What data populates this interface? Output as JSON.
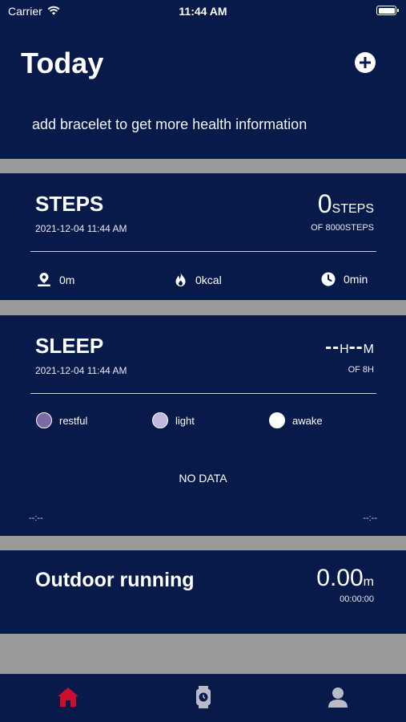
{
  "status_bar": {
    "carrier": "Carrier",
    "time": "11:44 AM",
    "wifi_icon": "wifi-icon",
    "battery_icon": "battery-icon"
  },
  "header": {
    "title": "Today",
    "add_icon": "plus-circle-icon",
    "banner": "add bracelet to get more health information"
  },
  "steps": {
    "title": "STEPS",
    "date": "2021-12-04 11:44 AM",
    "value": "0",
    "unit": "STEPS",
    "goal": "OF 8000STEPS",
    "metrics": [
      {
        "icon": "location-pin-icon",
        "value": "0m"
      },
      {
        "icon": "flame-icon",
        "value": "0kcal"
      },
      {
        "icon": "clock-icon",
        "value": "0min"
      }
    ]
  },
  "sleep": {
    "title": "SLEEP",
    "date": "2021-12-04 11:44 AM",
    "hours": "--",
    "hours_unit": "H",
    "minutes": "--",
    "minutes_unit": "M",
    "goal": "OF 8H",
    "legend": [
      {
        "label": "restful",
        "color": "#7b6aa6"
      },
      {
        "label": "light",
        "color": "#c2b8dc"
      },
      {
        "label": "awake",
        "color": "#ffffff"
      }
    ],
    "empty_text": "NO DATA",
    "start_time": "--:--",
    "end_time": "--:--"
  },
  "running": {
    "title": "Outdoor running",
    "distance": "0.00",
    "unit": "m",
    "duration": "00:00:00"
  },
  "tab_bar": {
    "tabs": [
      {
        "icon": "home-icon",
        "active": true,
        "color": "#c8102e"
      },
      {
        "icon": "watch-icon",
        "active": false,
        "color": "#b8bcc8"
      },
      {
        "icon": "profile-icon",
        "active": false,
        "color": "#b8bcc8"
      }
    ]
  }
}
